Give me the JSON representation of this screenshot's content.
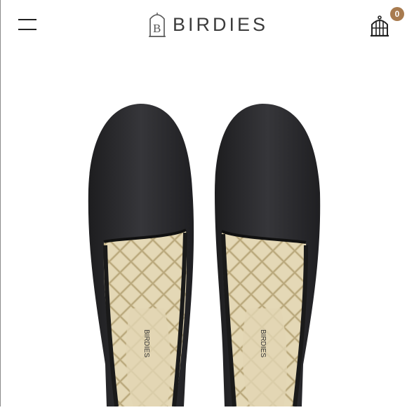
{
  "header": {
    "brand": "BIRDIES",
    "menu_icon": "hamburger-menu-icon",
    "cart_icon": "birdcage-cart-icon",
    "cart_count": "0",
    "accent_color": "#a87b4f"
  },
  "product_image": {
    "insole_brand": "BIRDIES",
    "shoe_color": "#2a2a2c",
    "lining_color": "#d8c9a0"
  }
}
